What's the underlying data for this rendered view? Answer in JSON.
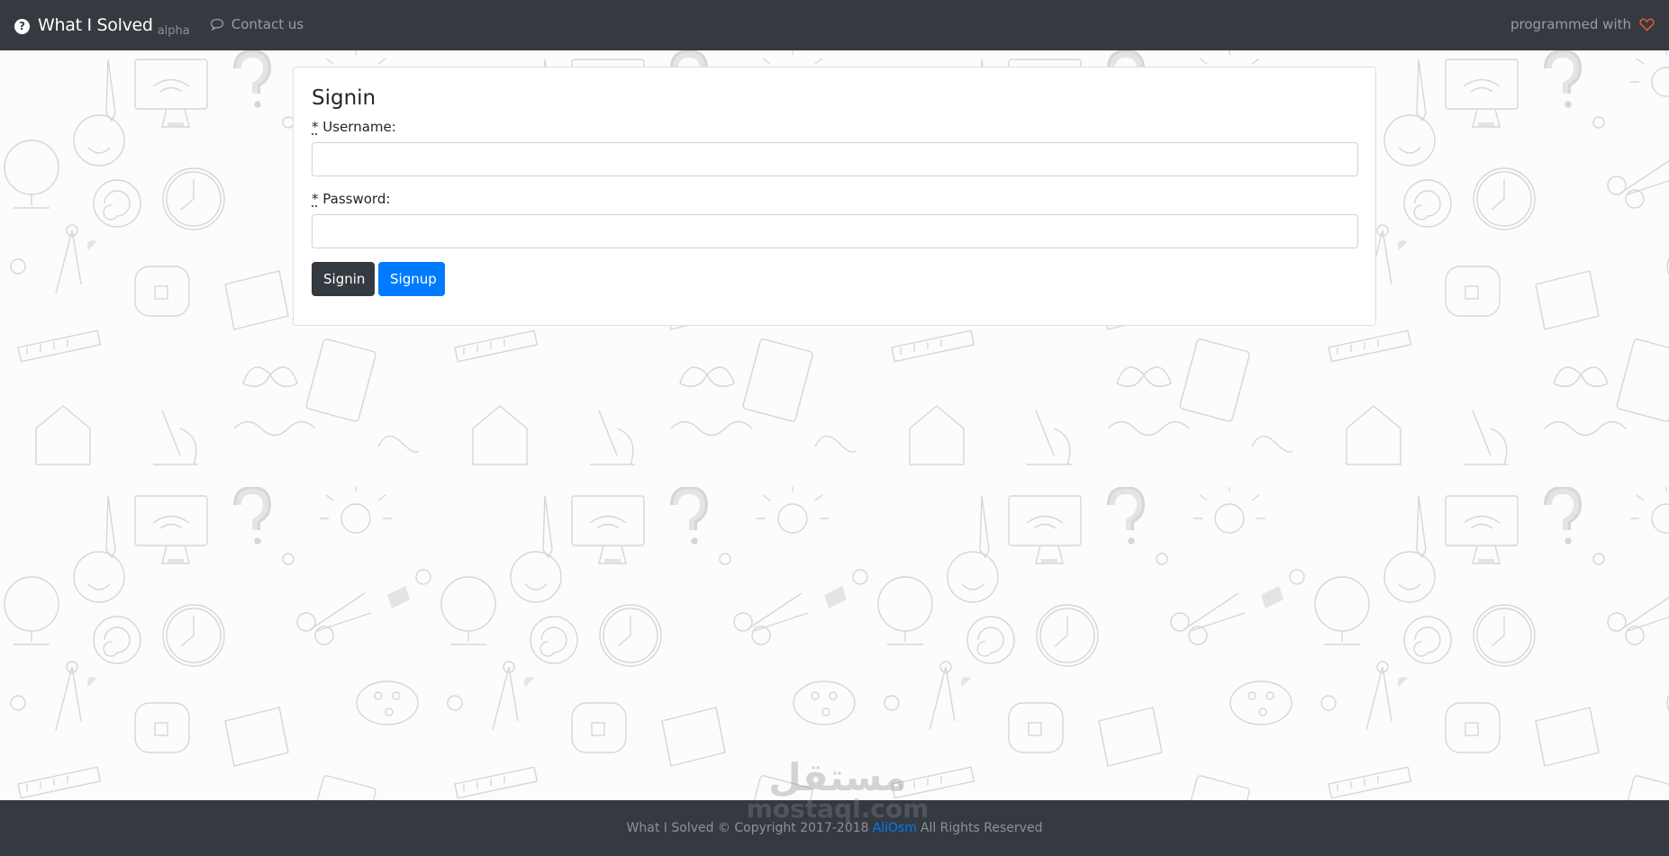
{
  "navbar": {
    "brand_icon": "question-circle-icon",
    "brand_name": "What I Solved",
    "brand_tag": "alpha",
    "contact_icon": "chat-bubble-icon",
    "contact_label": "Contact us",
    "right_text": "programmed with",
    "right_icon": "heart-icon",
    "heart_color": "#e0592a"
  },
  "signin": {
    "title": "Signin",
    "required_marker": "*",
    "username_label": "Username:",
    "username_value": "",
    "password_label": "Password:",
    "password_value": "",
    "signin_label": "Signin",
    "signup_label": "Signup"
  },
  "footer": {
    "prefix": "What I Solved © Copyright 2017-2018",
    "link": "AliOsm",
    "suffix": "All Rights Reserved",
    "link_color": "#007bff"
  },
  "watermark": {
    "arabic": "مستقل",
    "latin": "mostaql.com"
  },
  "colors": {
    "navbar_bg": "#343a40",
    "primary": "#007bff",
    "dark": "#343a40"
  }
}
